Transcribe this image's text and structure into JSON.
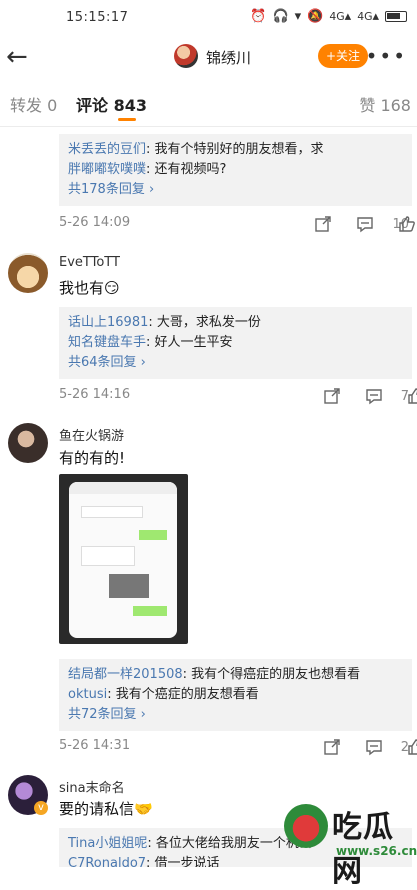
{
  "status": {
    "time": "15:15:17",
    "net1": "4G",
    "net2": "4G"
  },
  "nav": {
    "title": "锦绣川",
    "follow": "+关注",
    "more": "•••",
    "back": "←"
  },
  "tabs": {
    "repost": "转发 0",
    "comment": "评论 843",
    "like": "赞 168"
  },
  "comments": [
    {
      "replies": [
        {
          "user": "米丢丢的豆们",
          "text": ": 我有个特别好的朋友想看，求"
        },
        {
          "user": "胖嘟嘟软噗噗",
          "text": ": 还有视频吗?"
        }
      ],
      "more": "共178条回复 ›",
      "time": "5-26 14:09",
      "likes": "10"
    },
    {
      "name": "EveTToTT",
      "text": "我也有",
      "replies": [
        {
          "user": "话山上16981",
          "text": ": 大哥，求私发一份"
        },
        {
          "user": "知名键盘车手",
          "text": ": 好人一生平安"
        }
      ],
      "more": "共64条回复 ›",
      "time": "5-26 14:16",
      "likes": "7"
    },
    {
      "name": "鱼在火锅游",
      "text": "有的有的!",
      "replies": [
        {
          "user": "结局都一样201508",
          "text": ": 我有个得癌症的朋友也想看看"
        },
        {
          "user": "oktusi",
          "text": ": 我有个癌症的朋友想看看"
        }
      ],
      "more": "共72条回复 ›",
      "time": "5-26 14:31",
      "likes": "2"
    },
    {
      "name": "sina末命名",
      "text": "要的请私信",
      "replies": [
        {
          "user": "Tina小姐姐呢",
          "text": ": 各位大佬给我朋友一个机会"
        },
        {
          "user": "C7Ronaldo7",
          "text": ": 借一步说话"
        }
      ]
    }
  ],
  "watermark": {
    "brand": "吃瓜网",
    "url": "www.s26.cn"
  },
  "colors": {
    "accent": "#ff8200",
    "link": "#4a78b0",
    "reply_bg": "#f2f2f2"
  }
}
